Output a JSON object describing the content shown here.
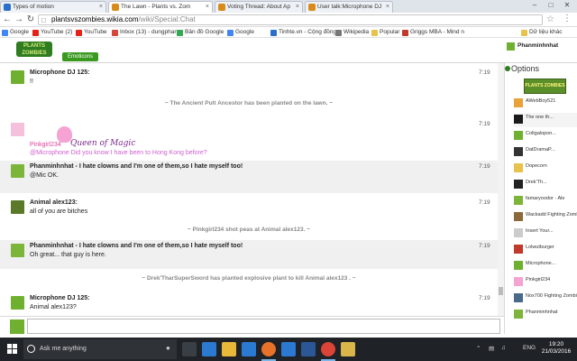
{
  "browser": {
    "tabs": [
      {
        "label": "Types of motion",
        "color": "#2a6fc9",
        "active": false
      },
      {
        "label": "The Lawn - Plants vs. Zom",
        "color": "#d98b1a",
        "active": true
      },
      {
        "label": "Voting Thread: About Ap",
        "color": "#d98b1a",
        "active": false
      },
      {
        "label": "User talk:Microphone DJ",
        "color": "#d98b1a",
        "active": false
      }
    ],
    "url_host": "plantsvszombies.wikia.com",
    "url_path": "/wiki/Special:Chat",
    "bookmarks": [
      {
        "label": "Google",
        "color": "#4285f4"
      },
      {
        "label": "YouTube (2)",
        "color": "#e62117"
      },
      {
        "label": "YouTube",
        "color": "#e62117"
      },
      {
        "label": "Inbox (13) - dungphan",
        "color": "#d44638"
      },
      {
        "label": "Bản đồ Google",
        "color": "#34a853"
      },
      {
        "label": "Google",
        "color": "#4285f4"
      },
      {
        "label": "Tinhte.vn - Cộng đồng",
        "color": "#2a6fc9"
      },
      {
        "label": "Wikipedia",
        "color": "#777777"
      },
      {
        "label": "Popular",
        "color": "#e8c34b"
      },
      {
        "label": "Griggs MBA - Mind n",
        "color": "#c0392b"
      },
      {
        "label": "Dữ liệu khác",
        "color": "#e8c34b"
      }
    ]
  },
  "header": {
    "logo_text": "PLANTS ZOMBIES",
    "emoticons_label": "Emoticons",
    "current_user": "Phanminhnhat"
  },
  "chat": {
    "messages": [
      {
        "type": "user",
        "name": "Microphone DJ 125:",
        "text": "!!",
        "time": "7:19",
        "grey": false,
        "avatar_color": "#6fb030"
      },
      {
        "type": "inline",
        "text": "~ The Ancient Pult Ancestor has been planted on the lawn. ~"
      },
      {
        "type": "user",
        "name": "Pinkgirl234",
        "text": "@Microphone Did you know I have been to Hong Kong before?",
        "time": "7:19",
        "grey": false,
        "avatar_color": "#f4c0dc",
        "pink": true,
        "signature": "Queen of Magic"
      },
      {
        "type": "user",
        "name": "Phanminhnhat - I hate clowns and I'm one of them,so I hate myself too!",
        "text": "@Mic OK.",
        "time": "7:19",
        "grey": true,
        "avatar_color": "#7db53a"
      },
      {
        "type": "user",
        "name": "Animal alex123:",
        "text": "all of you are bitches",
        "time": "7:19",
        "grey": false,
        "avatar_color": "#5a7a2a"
      },
      {
        "type": "inline",
        "text": "~ Pinkgirl234 shot peas at Animal alex123. ~"
      },
      {
        "type": "user",
        "name": "Phanminhnhat - I hate clowns and I'm one of them,so I hate myself too!",
        "text": "Oh great... that guy is here.",
        "time": "7:19",
        "grey": true,
        "avatar_color": "#7db53a"
      },
      {
        "type": "inline",
        "text": "~ Drek'TharSuperSword has planted explosive plant to kill Animal alex123 . ~"
      },
      {
        "type": "user",
        "name": "Microphone DJ 125:",
        "text": "Animal alex123?",
        "time": "7:19",
        "grey": false,
        "avatar_color": "#6fb030"
      }
    ],
    "input_value": ""
  },
  "sidebar": {
    "options_label": "Options",
    "banner_text": "PLANTS ZOMBIES",
    "users": [
      {
        "label": "AWebBoy521",
        "color": "#e8a23a"
      },
      {
        "label": "The one th...",
        "color": "#1a1a1a"
      },
      {
        "label": "Coltgalopon...",
        "color": "#6fb030"
      },
      {
        "label": "DatDramaP...",
        "color": "#333333"
      },
      {
        "label": "Dopecorn",
        "color": "#e8c34b"
      },
      {
        "label": "Drek'Th...",
        "color": "#222222"
      },
      {
        "label": "famaryoodor · Ale",
        "color": "#7db53a"
      },
      {
        "label": "Wackadd Fighting Zombies",
        "color": "#8a6a3a"
      },
      {
        "label": "Insert Your...",
        "color": "#cccccc"
      },
      {
        "label": "Lolwutburger",
        "color": "#c0392b"
      },
      {
        "label": "Microphone...",
        "color": "#6fb030"
      },
      {
        "label": "Pinkgirl234",
        "color": "#f4a3d3"
      },
      {
        "label": "Nox700 Fighting Zombies",
        "color": "#4a6a8a"
      },
      {
        "label": "Phanminhnhat",
        "color": "#7db53a"
      }
    ]
  },
  "taskbar": {
    "search_placeholder": "Ask me anything",
    "lang": "ENG",
    "time": "19:20",
    "date": "21/03/2016",
    "pinned": [
      {
        "name": "task-view-icon",
        "color": "#3a3f45"
      },
      {
        "name": "edge-icon",
        "color": "#2b79d0"
      },
      {
        "name": "file-explorer-icon",
        "color": "#e8b83a"
      },
      {
        "name": "store-icon",
        "color": "#2b79d0"
      },
      {
        "name": "firefox-icon",
        "color": "#e8722a"
      },
      {
        "name": "photos-icon",
        "color": "#2b79d0"
      },
      {
        "name": "word-icon",
        "color": "#2b5797"
      },
      {
        "name": "chrome-icon",
        "color": "#db4437"
      },
      {
        "name": "paint-icon",
        "color": "#d9b54a"
      }
    ]
  }
}
